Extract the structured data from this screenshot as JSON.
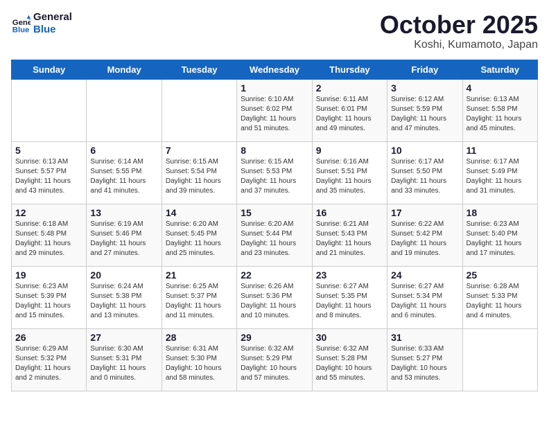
{
  "logo": {
    "line1": "General",
    "line2": "Blue"
  },
  "title": "October 2025",
  "subtitle": "Koshi, Kumamoto, Japan",
  "days_of_week": [
    "Sunday",
    "Monday",
    "Tuesday",
    "Wednesday",
    "Thursday",
    "Friday",
    "Saturday"
  ],
  "weeks": [
    [
      {
        "day": "",
        "info": ""
      },
      {
        "day": "",
        "info": ""
      },
      {
        "day": "",
        "info": ""
      },
      {
        "day": "1",
        "info": "Sunrise: 6:10 AM\nSunset: 6:02 PM\nDaylight: 11 hours\nand 51 minutes."
      },
      {
        "day": "2",
        "info": "Sunrise: 6:11 AM\nSunset: 6:01 PM\nDaylight: 11 hours\nand 49 minutes."
      },
      {
        "day": "3",
        "info": "Sunrise: 6:12 AM\nSunset: 5:59 PM\nDaylight: 11 hours\nand 47 minutes."
      },
      {
        "day": "4",
        "info": "Sunrise: 6:13 AM\nSunset: 5:58 PM\nDaylight: 11 hours\nand 45 minutes."
      }
    ],
    [
      {
        "day": "5",
        "info": "Sunrise: 6:13 AM\nSunset: 5:57 PM\nDaylight: 11 hours\nand 43 minutes."
      },
      {
        "day": "6",
        "info": "Sunrise: 6:14 AM\nSunset: 5:55 PM\nDaylight: 11 hours\nand 41 minutes."
      },
      {
        "day": "7",
        "info": "Sunrise: 6:15 AM\nSunset: 5:54 PM\nDaylight: 11 hours\nand 39 minutes."
      },
      {
        "day": "8",
        "info": "Sunrise: 6:15 AM\nSunset: 5:53 PM\nDaylight: 11 hours\nand 37 minutes."
      },
      {
        "day": "9",
        "info": "Sunrise: 6:16 AM\nSunset: 5:51 PM\nDaylight: 11 hours\nand 35 minutes."
      },
      {
        "day": "10",
        "info": "Sunrise: 6:17 AM\nSunset: 5:50 PM\nDaylight: 11 hours\nand 33 minutes."
      },
      {
        "day": "11",
        "info": "Sunrise: 6:17 AM\nSunset: 5:49 PM\nDaylight: 11 hours\nand 31 minutes."
      }
    ],
    [
      {
        "day": "12",
        "info": "Sunrise: 6:18 AM\nSunset: 5:48 PM\nDaylight: 11 hours\nand 29 minutes."
      },
      {
        "day": "13",
        "info": "Sunrise: 6:19 AM\nSunset: 5:46 PM\nDaylight: 11 hours\nand 27 minutes."
      },
      {
        "day": "14",
        "info": "Sunrise: 6:20 AM\nSunset: 5:45 PM\nDaylight: 11 hours\nand 25 minutes."
      },
      {
        "day": "15",
        "info": "Sunrise: 6:20 AM\nSunset: 5:44 PM\nDaylight: 11 hours\nand 23 minutes."
      },
      {
        "day": "16",
        "info": "Sunrise: 6:21 AM\nSunset: 5:43 PM\nDaylight: 11 hours\nand 21 minutes."
      },
      {
        "day": "17",
        "info": "Sunrise: 6:22 AM\nSunset: 5:42 PM\nDaylight: 11 hours\nand 19 minutes."
      },
      {
        "day": "18",
        "info": "Sunrise: 6:23 AM\nSunset: 5:40 PM\nDaylight: 11 hours\nand 17 minutes."
      }
    ],
    [
      {
        "day": "19",
        "info": "Sunrise: 6:23 AM\nSunset: 5:39 PM\nDaylight: 11 hours\nand 15 minutes."
      },
      {
        "day": "20",
        "info": "Sunrise: 6:24 AM\nSunset: 5:38 PM\nDaylight: 11 hours\nand 13 minutes."
      },
      {
        "day": "21",
        "info": "Sunrise: 6:25 AM\nSunset: 5:37 PM\nDaylight: 11 hours\nand 11 minutes."
      },
      {
        "day": "22",
        "info": "Sunrise: 6:26 AM\nSunset: 5:36 PM\nDaylight: 11 hours\nand 10 minutes."
      },
      {
        "day": "23",
        "info": "Sunrise: 6:27 AM\nSunset: 5:35 PM\nDaylight: 11 hours\nand 8 minutes."
      },
      {
        "day": "24",
        "info": "Sunrise: 6:27 AM\nSunset: 5:34 PM\nDaylight: 11 hours\nand 6 minutes."
      },
      {
        "day": "25",
        "info": "Sunrise: 6:28 AM\nSunset: 5:33 PM\nDaylight: 11 hours\nand 4 minutes."
      }
    ],
    [
      {
        "day": "26",
        "info": "Sunrise: 6:29 AM\nSunset: 5:32 PM\nDaylight: 11 hours\nand 2 minutes."
      },
      {
        "day": "27",
        "info": "Sunrise: 6:30 AM\nSunset: 5:31 PM\nDaylight: 11 hours\nand 0 minutes."
      },
      {
        "day": "28",
        "info": "Sunrise: 6:31 AM\nSunset: 5:30 PM\nDaylight: 10 hours\nand 58 minutes."
      },
      {
        "day": "29",
        "info": "Sunrise: 6:32 AM\nSunset: 5:29 PM\nDaylight: 10 hours\nand 57 minutes."
      },
      {
        "day": "30",
        "info": "Sunrise: 6:32 AM\nSunset: 5:28 PM\nDaylight: 10 hours\nand 55 minutes."
      },
      {
        "day": "31",
        "info": "Sunrise: 6:33 AM\nSunset: 5:27 PM\nDaylight: 10 hours\nand 53 minutes."
      },
      {
        "day": "",
        "info": ""
      }
    ]
  ]
}
